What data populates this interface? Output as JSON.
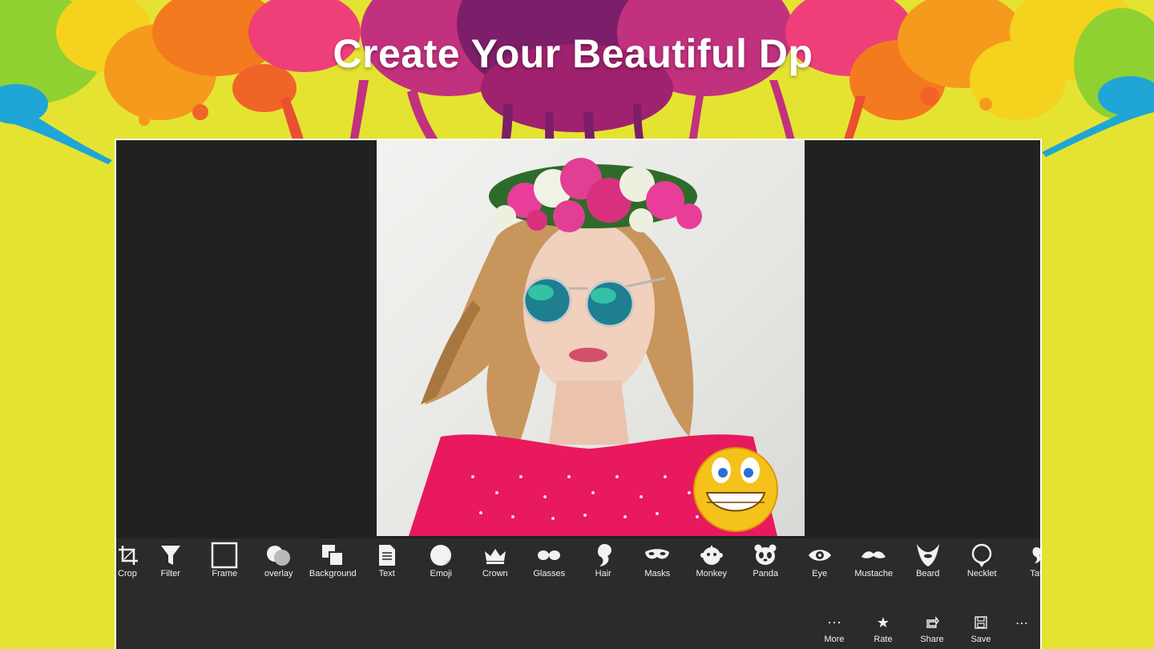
{
  "banner": {
    "title": "Create Your Beautiful Dp"
  },
  "toolbar": {
    "items": [
      {
        "label": "Crop",
        "icon": "crop-icon"
      },
      {
        "label": "Filter",
        "icon": "filter-icon"
      },
      {
        "label": "Frame",
        "icon": "frame-icon"
      },
      {
        "label": "overlay",
        "icon": "overlay-icon"
      },
      {
        "label": "Background",
        "icon": "background-icon"
      },
      {
        "label": "Text",
        "icon": "text-icon"
      },
      {
        "label": "Emoji",
        "icon": "emoji-icon"
      },
      {
        "label": "Crown",
        "icon": "crown-icon"
      },
      {
        "label": "Glasses",
        "icon": "glasses-icon"
      },
      {
        "label": "Hair",
        "icon": "hair-icon"
      },
      {
        "label": "Masks",
        "icon": "masks-icon"
      },
      {
        "label": "Monkey",
        "icon": "monkey-icon"
      },
      {
        "label": "Panda",
        "icon": "panda-icon"
      },
      {
        "label": "Eye",
        "icon": "eye-icon"
      },
      {
        "label": "Mustache",
        "icon": "mustache-icon"
      },
      {
        "label": "Beard",
        "icon": "beard-icon"
      },
      {
        "label": "Necklet",
        "icon": "necklet-icon"
      },
      {
        "label": "Tat",
        "icon": "tattoo-icon"
      }
    ]
  },
  "commandbar": {
    "more": {
      "label": "More",
      "glyph": "⋯",
      "icon": "more-icon"
    },
    "rate": {
      "label": "Rate",
      "glyph": "★",
      "icon": "star-icon"
    },
    "share": {
      "label": "Share",
      "glyph": "⟲",
      "icon": "share-icon"
    },
    "save": {
      "label": "Save",
      "glyph": "💾",
      "icon": "save-icon"
    },
    "overflow": "⋯"
  },
  "colors": {
    "background": "#e4e332",
    "app_dark": "#212121",
    "toolbar": "#2b2b2b",
    "dress": "#e8195d",
    "title": "#ffffff"
  }
}
